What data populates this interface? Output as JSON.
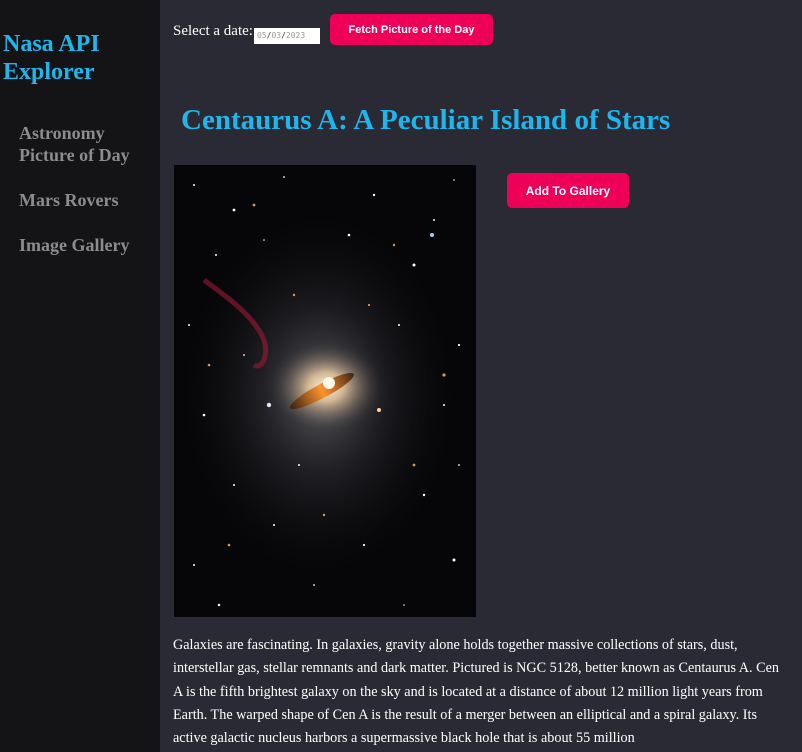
{
  "sidebar": {
    "brand": "Nasa API Explorer",
    "items": [
      {
        "label": "Astronomy Picture of Day"
      },
      {
        "label": "Mars Rovers"
      },
      {
        "label": "Image Gallery"
      }
    ]
  },
  "controls": {
    "date_label": "Select a date:",
    "date_value": {
      "month": "05",
      "day": "03",
      "year": "2023"
    },
    "fetch_label": "Fetch Picture of the Day"
  },
  "apod": {
    "title": "Centaurus A: A Peculiar Island of Stars",
    "image_subject": "galaxy-centaurus-a",
    "add_gallery_label": "Add To Gallery",
    "explanation": "Galaxies are fascinating. In galaxies, gravity alone holds together massive collections of stars, dust, interstellar gas, stellar remnants and dark matter. Pictured is NGC 5128, better known as Centaurus A. Cen A is the fifth brightest galaxy on the sky and is located at a distance of about 12 million light years from Earth. The warped shape of Cen A is the result of a merger between an elliptical and a spiral galaxy. Its active galactic nucleus harbors a supermassive black hole that is about 55 million"
  },
  "colors": {
    "accent": "#1fb6ee",
    "button": "#ef0058",
    "sidebar_bg": "#141416",
    "main_bg": "#2a2a35",
    "nav_text": "#8c8c8c"
  }
}
